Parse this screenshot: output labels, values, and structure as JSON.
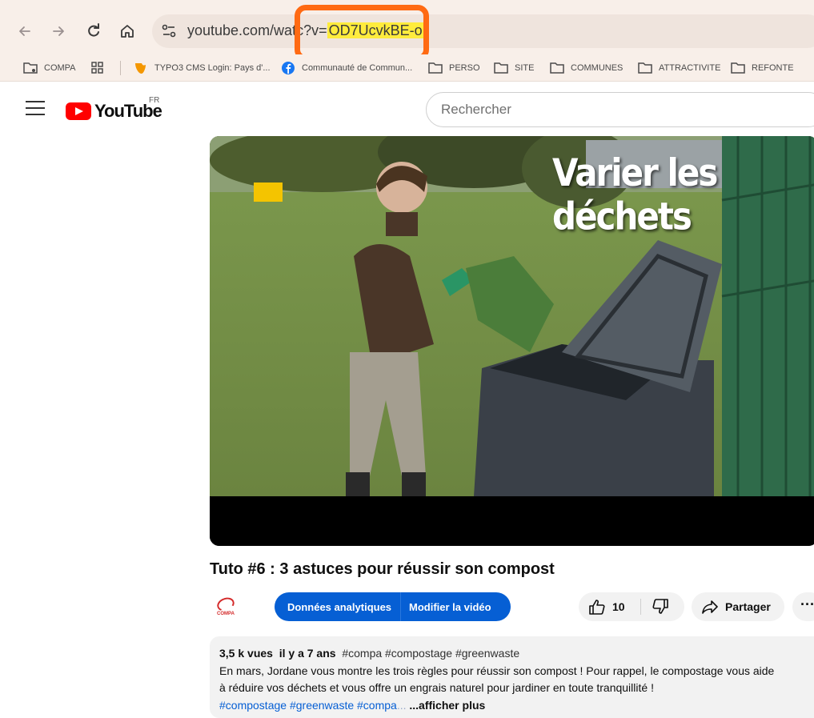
{
  "browser": {
    "url_prefix": "youtube.com/watc",
    "url_middle": "?v=",
    "url_highlight": "OD7UcvkBE-o",
    "highlight_color": "#ff6a13",
    "bookmarks": [
      {
        "label": "COMPA",
        "icon": "folder-settings-icon"
      },
      {
        "label": "",
        "icon": "apps-grid-icon"
      },
      {
        "label": "TYPO3 CMS Login: Pays d'...",
        "icon": "typo3-icon"
      },
      {
        "label": "Communauté de Commun...",
        "icon": "facebook-icon"
      },
      {
        "label": "PERSO",
        "icon": "folder-icon"
      },
      {
        "label": "SITE",
        "icon": "folder-icon"
      },
      {
        "label": "COMMUNES",
        "icon": "folder-icon"
      },
      {
        "label": "ATTRACTIVITE",
        "icon": "folder-icon"
      },
      {
        "label": "REFONTE",
        "icon": "folder-icon"
      }
    ]
  },
  "youtube": {
    "wordmark": "YouTube",
    "country": "FR",
    "search_placeholder": "Rechercher",
    "brand_color": "#ff0000",
    "accent_color": "#065fd4"
  },
  "video": {
    "overlay_text": "Varier les déchets",
    "title": "Tuto #6 : 3 astuces pour réussir son compost"
  },
  "channel": {
    "avatar_text": "COMPA"
  },
  "actions": {
    "analytics_label": "Données analytiques",
    "edit_label": "Modifier la vidéo",
    "like_count": "10",
    "share_label": "Partager",
    "more_label": "···"
  },
  "description": {
    "views": "3,5 k vues",
    "date": "il y a 7 ans",
    "meta_tags": "#compa #compostage #greenwaste",
    "line1": "En mars, Jordane vous montre les trois règles pour réussir son compost ! Pour rappel, le compostage vous aide",
    "line2": "à réduire vos déchets et vous offre un engrais naturel pour jardiner en toute tranquillité !",
    "tag1": "#compostage",
    "tag2": "#greenwaste",
    "tag3": "#compa",
    "tag3_fade": "...",
    "more": "...afficher plus"
  }
}
